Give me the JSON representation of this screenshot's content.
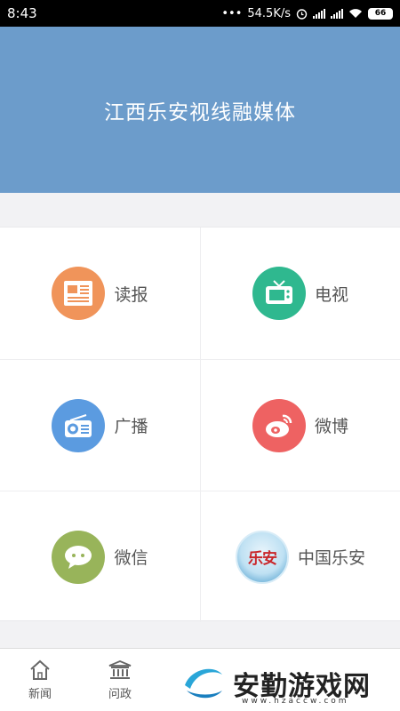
{
  "status_bar": {
    "time": "8:43",
    "network_speed": "54.5K/s",
    "battery": "66"
  },
  "header": {
    "title": "江西乐安视线融媒体",
    "background_color": "#6c9ccb"
  },
  "grid": {
    "items": [
      {
        "label": "读报",
        "icon": "newspaper-icon",
        "color": "#f0945a"
      },
      {
        "label": "电视",
        "icon": "tv-icon",
        "color": "#2fb88f"
      },
      {
        "label": "广播",
        "icon": "radio-icon",
        "color": "#5b9be0"
      },
      {
        "label": "微博",
        "icon": "weibo-icon",
        "color": "#ee6262"
      },
      {
        "label": "微信",
        "icon": "wechat-icon",
        "color": "#98b45a"
      },
      {
        "label": "中国乐安",
        "icon": "lean-logo-icon",
        "logo_text": "乐安"
      }
    ]
  },
  "bottom_nav": {
    "items": [
      {
        "label": "新闻",
        "icon": "home-icon"
      },
      {
        "label": "问政",
        "icon": "government-icon"
      }
    ]
  },
  "watermark": {
    "text": "安勤游戏网",
    "url": "www.hzaccw.com"
  }
}
